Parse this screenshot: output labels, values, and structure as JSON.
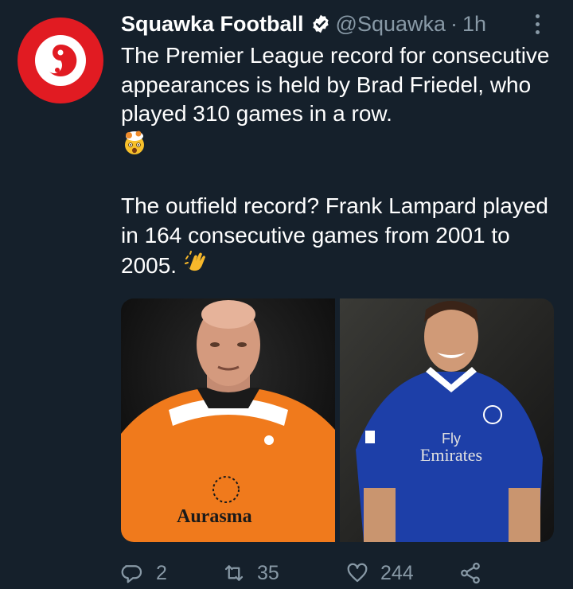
{
  "tweet": {
    "display_name": "Squawka Football",
    "handle": "@Squawka",
    "separator": "·",
    "time": "1h",
    "paragraph1": "The Premier League record for consecutive appearances is held by Brad Friedel, who played 310 games in a row.",
    "emoji1": "exploding-head-emoji",
    "paragraph2": "The outfield record? Frank Lampard played in 164 consecutive games from 2001 to 2005.",
    "emoji2": "clapping-hands-emoji"
  },
  "media": {
    "left_photo": {
      "subject": "goalkeeper in orange kit",
      "kit_sponsor": "Aurasma",
      "kit_color": "#f07a1c"
    },
    "right_photo": {
      "subject": "player in blue kit",
      "kit_sponsor_line1": "Fly",
      "kit_sponsor_line2": "Emirates",
      "kit_color": "#1d3fa8"
    }
  },
  "actions": {
    "replies": "2",
    "retweets": "35",
    "likes": "244"
  },
  "colors": {
    "background": "#15202b",
    "secondary_text": "#8899a6",
    "brand_red": "#e11b22"
  }
}
